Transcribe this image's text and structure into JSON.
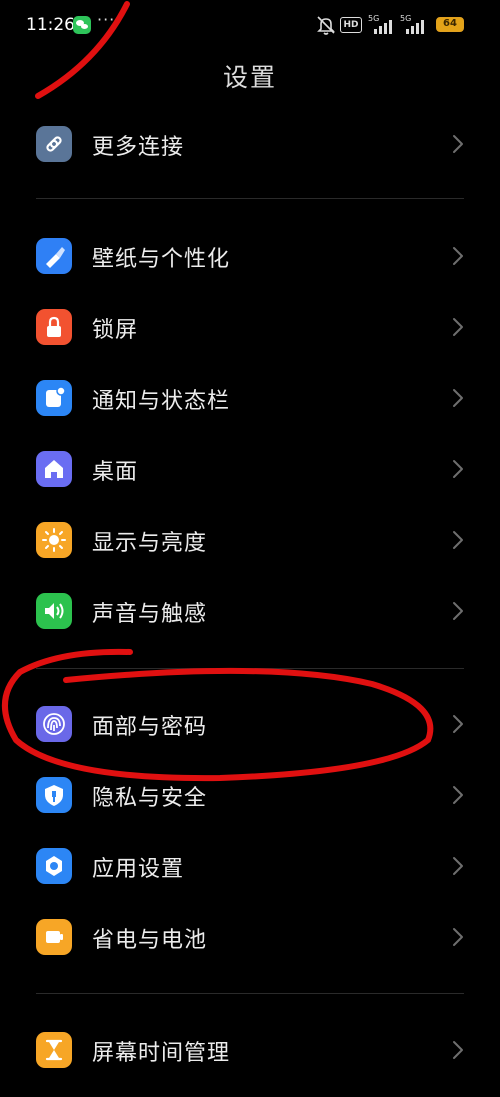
{
  "status_bar": {
    "time": "11:26",
    "more": "···",
    "hd_label": "HD",
    "signal1_label": "5G",
    "signal2_label": "5G",
    "battery": "64"
  },
  "page": {
    "title": "设置"
  },
  "groups": [
    {
      "items": [
        {
          "label": "更多连接",
          "icon": "link-icon",
          "color": "#5a7598"
        }
      ]
    },
    {
      "items": [
        {
          "label": "壁纸与个性化",
          "icon": "brush-icon",
          "color": "#2f80f5"
        },
        {
          "label": "锁屏",
          "icon": "lock-icon",
          "color": "#f25230"
        },
        {
          "label": "通知与状态栏",
          "icon": "notification-icon",
          "color": "#2c86f5"
        },
        {
          "label": "桌面",
          "icon": "home-icon",
          "color": "#6a6df2"
        },
        {
          "label": "显示与亮度",
          "icon": "sun-icon",
          "color": "#f7a626"
        },
        {
          "label": "声音与触感",
          "icon": "speaker-icon",
          "color": "#2cc24e"
        }
      ]
    },
    {
      "items": [
        {
          "label": "面部与密码",
          "icon": "fingerprint-icon",
          "color": "#6a68e8"
        },
        {
          "label": "隐私与安全",
          "icon": "privacy-shield-icon",
          "color": "#2c86f5"
        },
        {
          "label": "应用设置",
          "icon": "app-settings-gear-icon",
          "color": "#2c86f5"
        },
        {
          "label": "省电与电池",
          "icon": "battery-icon",
          "color": "#f7a626"
        }
      ]
    },
    {
      "items": [
        {
          "label": "屏幕时间管理",
          "icon": "hourglass-icon",
          "color": "#f7a626"
        }
      ]
    }
  ],
  "colors": {
    "background": "#000000",
    "annotation": "#e01010",
    "divider": "#2a2a2a",
    "chevron": "#6e6e6e"
  }
}
